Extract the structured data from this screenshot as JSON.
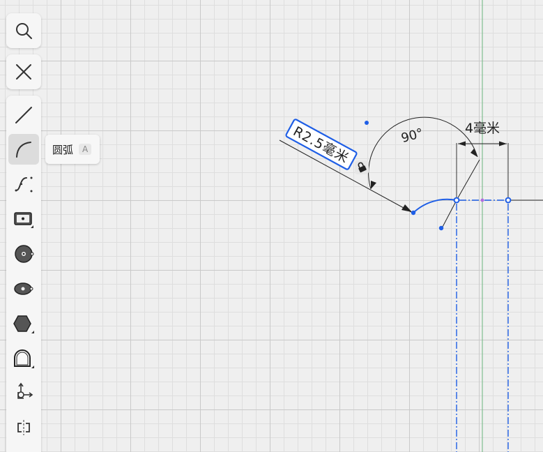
{
  "toolbar": {
    "search_icon": "search-icon",
    "close_icon": "close-icon",
    "tools": [
      {
        "icon": "line-icon"
      },
      {
        "icon": "arc-icon"
      },
      {
        "icon": "spline-icon"
      },
      {
        "icon": "rectangle-icon"
      },
      {
        "icon": "circle-icon"
      },
      {
        "icon": "ellipse-icon"
      },
      {
        "icon": "polygon-icon"
      },
      {
        "icon": "slot-icon"
      },
      {
        "icon": "transform-icon"
      },
      {
        "icon": "mirror-icon"
      }
    ],
    "active_tool": "arc"
  },
  "tooltip": {
    "label": "圆弧",
    "shortcut": "A"
  },
  "sketch": {
    "radius_label": "R2.5毫米",
    "angle_label": "90°",
    "width_label": "4毫米",
    "colors": {
      "selection": "#1e5ee6",
      "dimension": "#222222",
      "axis": "#7fbf8f",
      "midpoint": "#b36be0"
    }
  }
}
